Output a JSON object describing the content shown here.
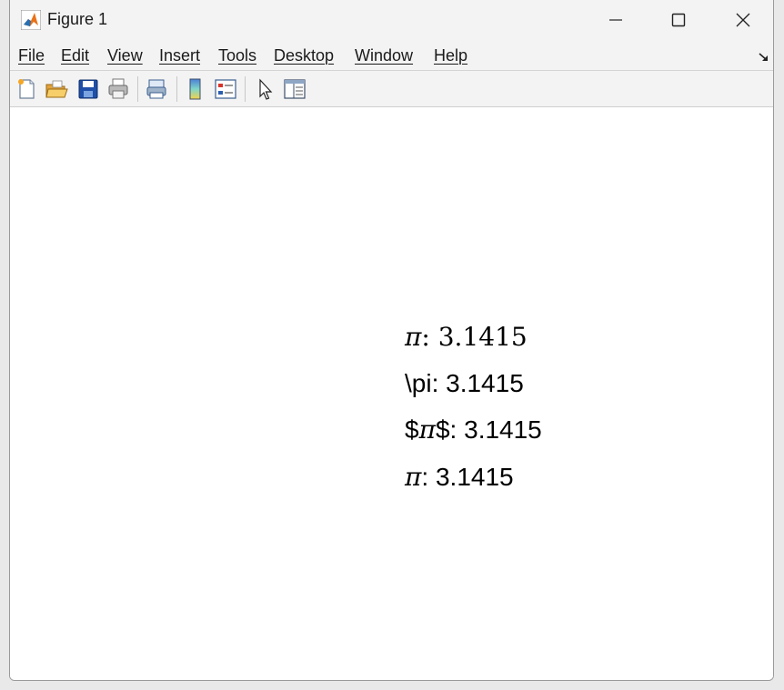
{
  "window": {
    "title": "Figure 1",
    "controls": {
      "minimize": "minimize",
      "maximize": "maximize",
      "close": "close"
    }
  },
  "menubar": {
    "items": [
      "File",
      "Edit",
      "View",
      "Insert",
      "Tools",
      "Desktop",
      "Window",
      "Help"
    ]
  },
  "toolbar": {
    "buttons": [
      "new-figure",
      "open-file",
      "save-figure",
      "print-figure",
      "print-preview",
      "insert-colorbar",
      "insert-legend",
      "edit-plot",
      "property-inspector"
    ]
  },
  "figure": {
    "lines": [
      {
        "symbol": "π",
        "text": ":  3.1415"
      },
      {
        "text": "\\pi: 3.1415"
      },
      {
        "prefix": "$",
        "symbol": "π",
        "text": "$: 3.1415"
      },
      {
        "symbol": "π",
        "text": ": 3.1415"
      }
    ]
  },
  "colors": {
    "chrome": "#f3f3f3",
    "canvas": "#ffffff",
    "text": "#000000",
    "matlab_orange": "#e8731a",
    "save_blue": "#1f4fa8"
  }
}
